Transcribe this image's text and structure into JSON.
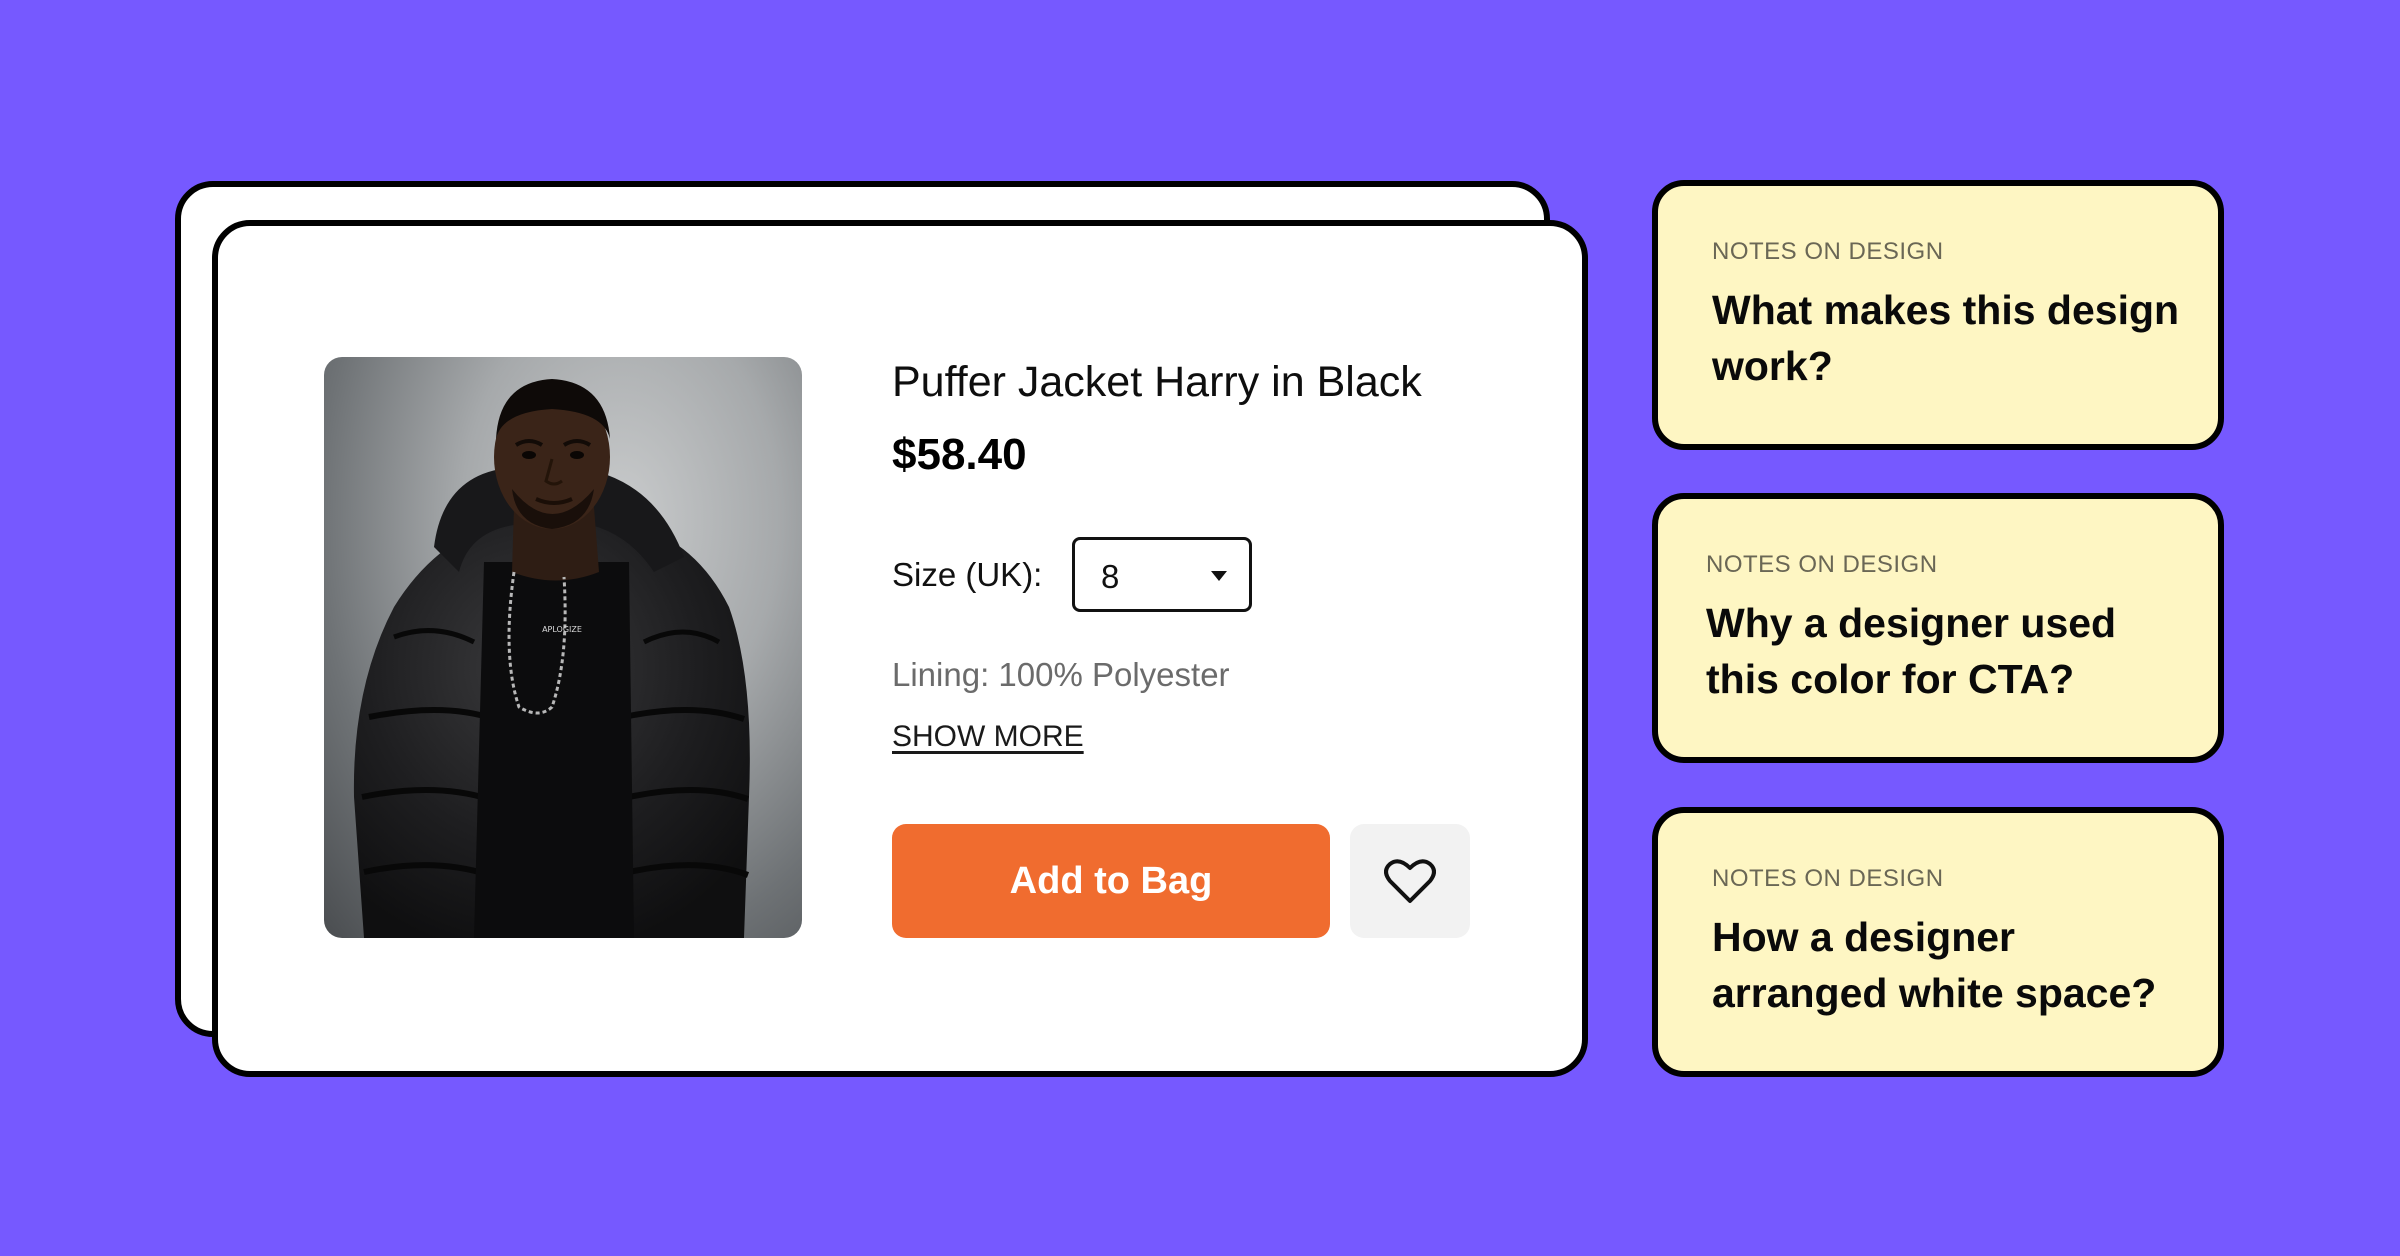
{
  "colors": {
    "background": "#7659FF",
    "card": "#FFFFFF",
    "card_border": "#000000",
    "cta": "#F06C2F",
    "cta_text": "#FFFFFF",
    "wishlist_bg": "#F2F2F2",
    "note_bg": "#FEF6C3",
    "muted_text": "#6B6B6B"
  },
  "product": {
    "title": "Puffer Jacket Harry in Black",
    "price": "$58.40",
    "size_label": "Size (UK):",
    "size_selected": "8",
    "lining": "Lining: 100% Polyester",
    "show_more": "SHOW MORE",
    "add_to_bag": "Add to Bag",
    "wishlist_icon": "heart-icon",
    "dropdown_icon": "caret-down-icon",
    "photo_text": "APLOGIZE"
  },
  "notes": [
    {
      "eyebrow": "NOTES ON DESIGN",
      "question": "What makes this design work?"
    },
    {
      "eyebrow": "NOTES ON DESIGN",
      "question": "Why a designer used this color for CTA?"
    },
    {
      "eyebrow": "NOTES ON DESIGN",
      "question": "How a designer arranged white space?"
    }
  ]
}
